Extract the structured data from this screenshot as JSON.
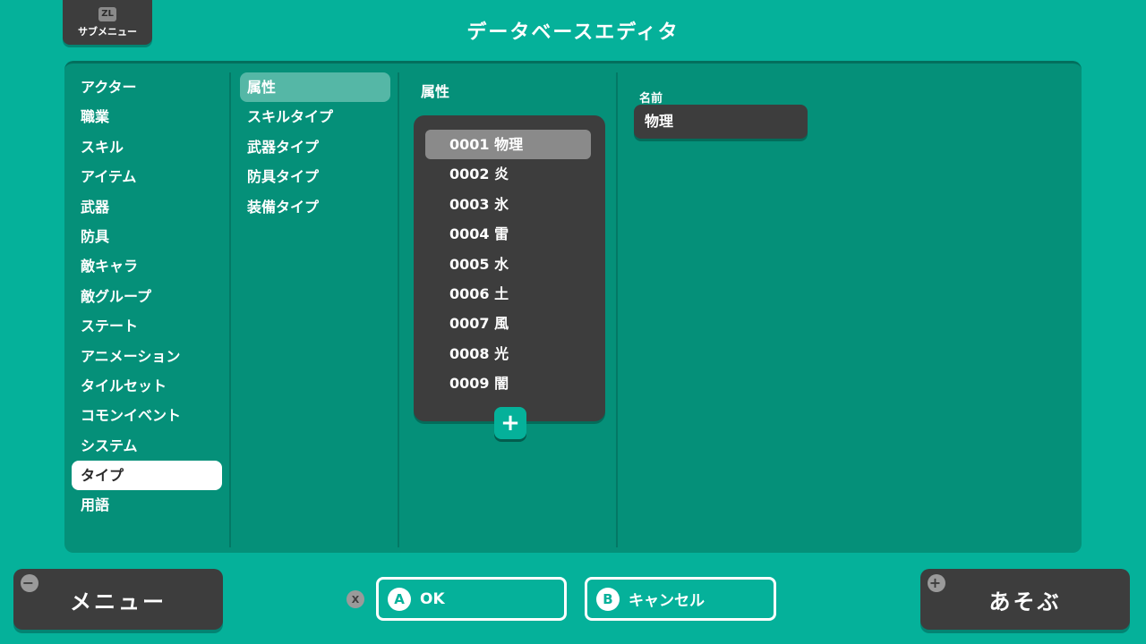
{
  "header": {
    "title": "データベースエディタ",
    "submenu_key": "ZL",
    "submenu_label": "サブメニュー"
  },
  "categories": [
    {
      "label": "アクター"
    },
    {
      "label": "職業"
    },
    {
      "label": "スキル"
    },
    {
      "label": "アイテム"
    },
    {
      "label": "武器"
    },
    {
      "label": "防具"
    },
    {
      "label": "敵キャラ"
    },
    {
      "label": "敵グループ"
    },
    {
      "label": "ステート"
    },
    {
      "label": "アニメーション"
    },
    {
      "label": "タイルセット"
    },
    {
      "label": "コモンイベント"
    },
    {
      "label": "システム"
    },
    {
      "label": "タイプ"
    },
    {
      "label": "用語"
    }
  ],
  "selected_category": "タイプ",
  "subcategories": [
    {
      "label": "属性"
    },
    {
      "label": "スキルタイプ"
    },
    {
      "label": "武器タイプ"
    },
    {
      "label": "防具タイプ"
    },
    {
      "label": "装備タイプ"
    }
  ],
  "selected_subcategory": "属性",
  "type_list": {
    "title": "属性",
    "items": [
      {
        "label": "0001 物理"
      },
      {
        "label": "0002 炎"
      },
      {
        "label": "0003 氷"
      },
      {
        "label": "0004 雷"
      },
      {
        "label": "0005 水"
      },
      {
        "label": "0006 土"
      },
      {
        "label": "0007 風"
      },
      {
        "label": "0008 光"
      },
      {
        "label": "0009 闇"
      }
    ],
    "selected_index": 0,
    "add_label": "+"
  },
  "detail": {
    "name_label": "名前",
    "name_value": "物理"
  },
  "footer": {
    "menu_label": "メニュー",
    "menu_key": "−",
    "x_key": "X",
    "ok_key": "A",
    "ok_label": "OK",
    "cancel_key": "B",
    "cancel_label": "キャンセル",
    "play_key": "+",
    "play_label": "あそぶ"
  },
  "colors": {
    "background": "#05b19a",
    "panel": "#059079",
    "dark": "#3d3d3d",
    "selected_sub": "#55b7a6"
  }
}
